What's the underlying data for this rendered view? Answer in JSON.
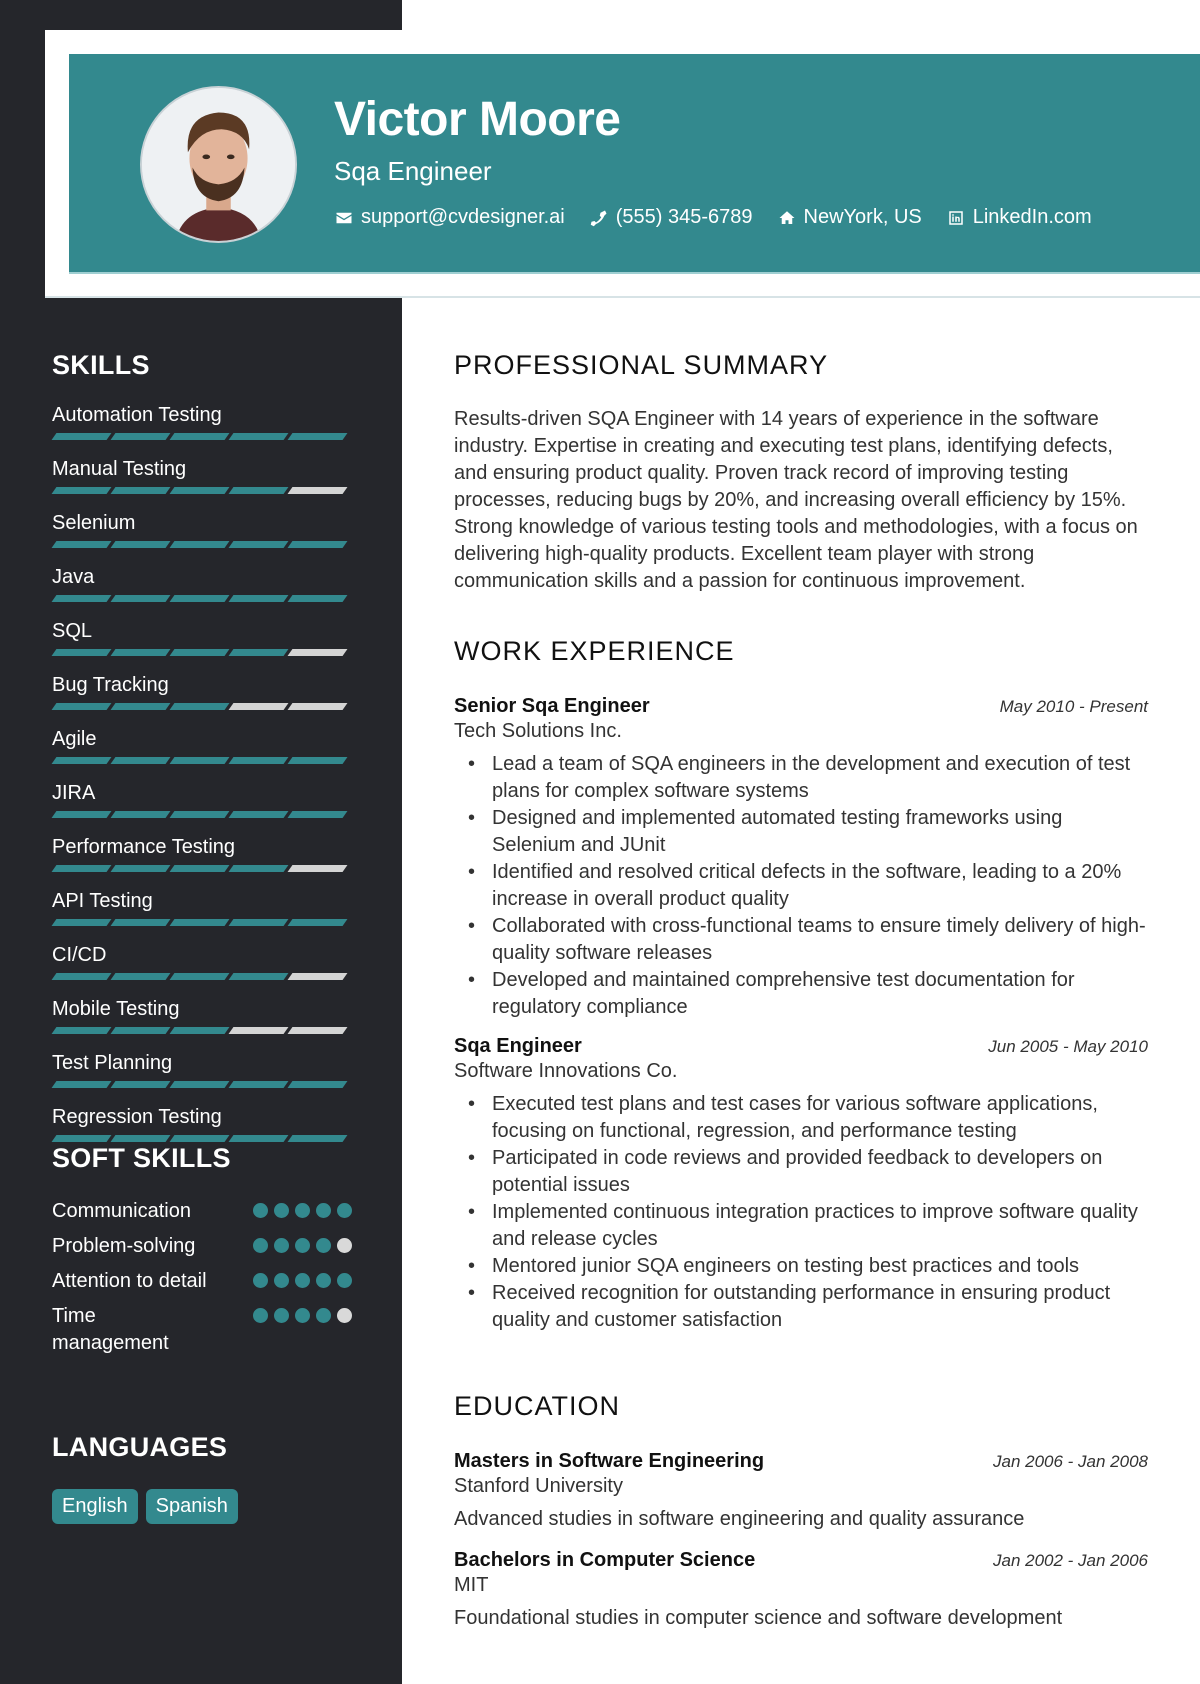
{
  "header": {
    "name": "Victor Moore",
    "role": "Sqa Engineer",
    "contacts": [
      {
        "icon": "envelope-icon",
        "text": "support@cvdesigner.ai"
      },
      {
        "icon": "phone-icon",
        "text": "(555) 345-6789"
      },
      {
        "icon": "home-icon",
        "text": "NewYork, US"
      },
      {
        "icon": "linkedin-icon",
        "text": "LinkedIn.com"
      }
    ]
  },
  "colors": {
    "accent": "#33898e",
    "sidebar": "#25262b",
    "inactive": "#d4d4d4"
  },
  "sidebar": {
    "skills_title": "SKILLS",
    "skills": [
      {
        "name": "Automation Testing",
        "level": 5,
        "max": 5
      },
      {
        "name": "Manual Testing",
        "level": 4,
        "max": 5
      },
      {
        "name": "Selenium",
        "level": 5,
        "max": 5
      },
      {
        "name": "Java",
        "level": 5,
        "max": 5
      },
      {
        "name": "SQL",
        "level": 4,
        "max": 5
      },
      {
        "name": "Bug Tracking",
        "level": 3,
        "max": 5
      },
      {
        "name": "Agile",
        "level": 5,
        "max": 5
      },
      {
        "name": "JIRA",
        "level": 5,
        "max": 5
      },
      {
        "name": "Performance Testing",
        "level": 4,
        "max": 5
      },
      {
        "name": "API Testing",
        "level": 5,
        "max": 5
      },
      {
        "name": "CI/CD",
        "level": 4,
        "max": 5
      },
      {
        "name": "Mobile Testing",
        "level": 3,
        "max": 5
      },
      {
        "name": "Test Planning",
        "level": 5,
        "max": 5
      },
      {
        "name": "Regression Testing",
        "level": 5,
        "max": 5
      }
    ],
    "soft_skills_title": "SOFT SKILLS",
    "soft_skills": [
      {
        "name": "Communication",
        "level": 5,
        "max": 5
      },
      {
        "name": "Problem-solving",
        "level": 4,
        "max": 5
      },
      {
        "name": "Attention to detail",
        "level": 5,
        "max": 5
      },
      {
        "name": "Time management",
        "level": 4,
        "max": 5
      }
    ],
    "languages_title": "LANGUAGES",
    "languages": [
      "English",
      "Spanish"
    ]
  },
  "main": {
    "summary_title": "PROFESSIONAL SUMMARY",
    "summary": "Results-driven SQA Engineer with 14 years of experience in the software industry. Expertise in creating and executing test plans, identifying defects, and ensuring product quality. Proven track record of improving testing processes, reducing bugs by 20%, and increasing overall efficiency by 15%. Strong knowledge of various testing tools and methodologies, with a focus on delivering high-quality products. Excellent team player with strong communication skills and a passion for continuous improvement.",
    "experience_title": "WORK EXPERIENCE",
    "experience": [
      {
        "title": "Senior Sqa Engineer",
        "company": "Tech Solutions Inc.",
        "dates": "May 2010 - Present",
        "bullets": [
          "Lead a team of SQA engineers in the development and execution of test plans for complex software systems",
          "Designed and implemented automated testing frameworks using Selenium and JUnit",
          "Identified and resolved critical defects in the software, leading to a 20% increase in overall product quality",
          "Collaborated with cross-functional teams to ensure timely delivery of high-quality software releases",
          "Developed and maintained comprehensive test documentation for regulatory compliance"
        ]
      },
      {
        "title": "Sqa Engineer",
        "company": "Software Innovations Co.",
        "dates": "Jun 2005 - May 2010",
        "bullets": [
          "Executed test plans and test cases for various software applications, focusing on functional, regression, and performance testing",
          "Participated in code reviews and provided feedback to developers on potential issues",
          "Implemented continuous integration practices to improve software quality and release cycles",
          "Mentored junior SQA engineers on testing best practices and tools",
          "Received recognition for outstanding performance in ensuring product quality and customer satisfaction"
        ]
      }
    ],
    "education_title": "EDUCATION",
    "education": [
      {
        "degree": "Masters in Software Engineering",
        "school": "Stanford University",
        "dates": "Jan 2006 - Jan 2008",
        "description": "Advanced studies in software engineering and quality assurance"
      },
      {
        "degree": "Bachelors in Computer Science",
        "school": "MIT",
        "dates": "Jan 2002 - Jan 2006",
        "description": "Foundational studies in computer science and software development"
      }
    ]
  }
}
